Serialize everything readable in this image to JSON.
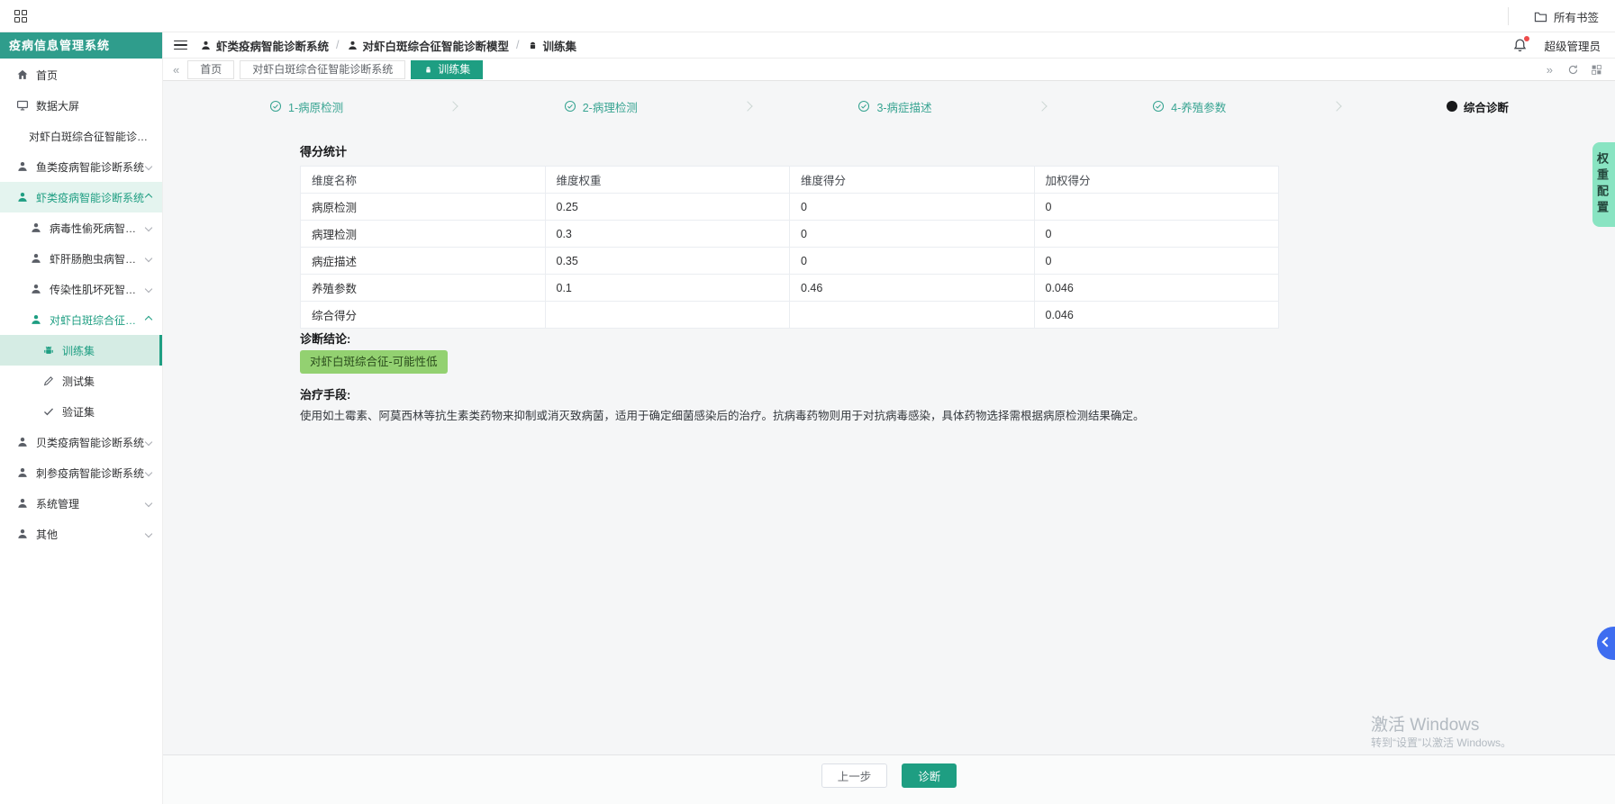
{
  "topbar": {
    "bookmarks_label": "所有书签"
  },
  "sidebar": {
    "title": "疫病信息管理系统",
    "items": [
      {
        "label": "首页"
      },
      {
        "label": "数据大屏"
      },
      {
        "label": "对虾白斑综合征智能诊断系统"
      },
      {
        "label": "鱼类疫病智能诊断系统"
      },
      {
        "label": "虾类疫病智能诊断系统"
      },
      {
        "label": "病毒性偷死病智能诊断模型"
      },
      {
        "label": "虾肝肠胞虫病智能诊断模型"
      },
      {
        "label": "传染性肌坏死智能诊断模型"
      },
      {
        "label": "对虾白斑综合征智能诊断模型"
      },
      {
        "label": "训练集"
      },
      {
        "label": "测试集"
      },
      {
        "label": "验证集"
      },
      {
        "label": "贝类疫病智能诊断系统"
      },
      {
        "label": "刺参疫病智能诊断系统"
      },
      {
        "label": "系统管理"
      },
      {
        "label": "其他"
      }
    ]
  },
  "header": {
    "breadcrumbs": [
      "虾类疫病智能诊断系统",
      "对虾白斑综合征智能诊断模型",
      "训练集"
    ],
    "separator": "/",
    "user": "超级管理员"
  },
  "tabs": {
    "items": [
      "首页",
      "对虾白斑综合征智能诊断系统",
      "训练集"
    ],
    "active": "训练集",
    "scroll_left": "«",
    "scroll_right": "»"
  },
  "stepper": {
    "steps": [
      "1-病原检测",
      "2-病理检测",
      "3-病症描述",
      "4-养殖参数",
      "综合诊断"
    ],
    "current": "综合诊断"
  },
  "main": {
    "score_title": "得分统计",
    "table": {
      "headers": [
        "维度名称",
        "维度权重",
        "维度得分",
        "加权得分"
      ],
      "rows": [
        [
          "病原检测",
          "0.25",
          "0",
          "0"
        ],
        [
          "病理检测",
          "0.3",
          "0",
          "0"
        ],
        [
          "病症描述",
          "0.35",
          "0",
          "0"
        ],
        [
          "养殖参数",
          "0.1",
          "0.46",
          "0.046"
        ],
        [
          "综合得分",
          "",
          "",
          "0.046"
        ]
      ]
    },
    "conclusion_label": "诊断结论:",
    "conclusion_badge": "对虾白斑综合征-可能性低",
    "treatment_label": "治疗手段:",
    "treatment_text": "使用如土霉素、阿莫西林等抗生素类药物来抑制或消灭致病菌，适用于确定细菌感染后的治疗。抗病毒药物则用于对抗病毒感染，具体药物选择需根据病原检测结果确定。",
    "buttons": {
      "prev": "上一步",
      "diagnose": "诊断"
    }
  },
  "side_widgets": {
    "weight_config": "权重配置"
  },
  "watermark": {
    "line1": "激活 Windows",
    "line2": "转到“设置”以激活 Windows。"
  },
  "colors": {
    "primary_teal": "#1e9e82",
    "sidebar_header_teal": "#2f9d8c",
    "menu_active_bg": "#d5ece4",
    "badge_bg": "#93d171",
    "badge_text": "#2b4d1d",
    "mint_side_tab": "#89e4c2",
    "collapse_blue": "#3e6df0",
    "notification_dot": "#ee4b4b",
    "watermark_gray": "#b3bac1"
  }
}
